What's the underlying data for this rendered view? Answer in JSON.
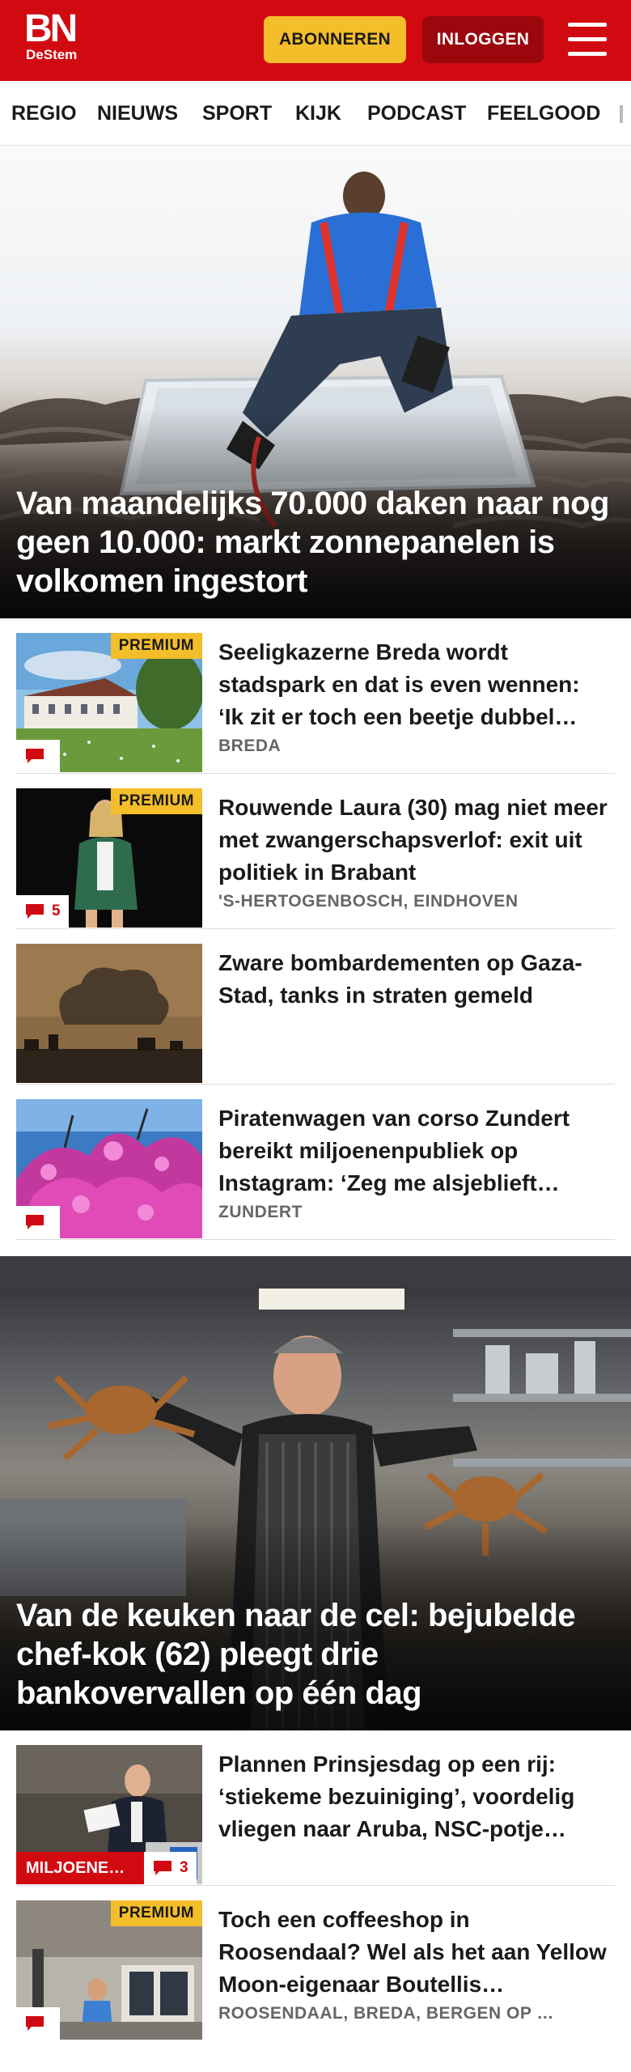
{
  "header": {
    "logo_main": "BN",
    "logo_sub": "DeStem",
    "subscribe_label": "ABONNEREN",
    "login_label": "INLOGGEN",
    "brand_color": "#d10a11",
    "subscribe_color": "#f4bd2a"
  },
  "nav": {
    "items": [
      "REGIO",
      "NIEUWS",
      "SPORT",
      "KIJK",
      "PODCAST",
      "FEELGOOD"
    ]
  },
  "hero_1": {
    "title": "Van maandelijks 70.000 daken naar nog geen 10.000: markt zonnepanelen is volkomen ingestort"
  },
  "articles_1": [
    {
      "title": "Seeligkazerne Breda wordt stadspark en dat is even wennen: ‘Ik zit er toch een beetje dubbel…",
      "location": "BREDA",
      "badge": "PREMIUM",
      "comments": ""
    },
    {
      "title": "Rouwende Laura (30) mag niet meer met zwangerschapsverlof: exit uit politiek in Brabant",
      "location": "'S-HERTOGENBOSCH, EINDHOVEN",
      "badge": "PREMIUM",
      "comments": "5"
    },
    {
      "title": "Zware bombardementen op Gaza-Stad, tanks in straten gemeld"
    },
    {
      "title": "Piratenwagen van corso Zundert bereikt miljoenenpubliek op Instagram: ‘Zeg me alsjeblieft…",
      "location": "ZUNDERT",
      "comments": ""
    }
  ],
  "hero_2": {
    "title": "Van de keuken naar de cel: bejubelde chef-kok (62) pleegt drie bankovervallen op één dag"
  },
  "articles_2": [
    {
      "title": "Plannen Prinsjesdag op een rij: ‘stiekeme bezuiniging’, voordelig vliegen naar Aruba, NSC-potje…",
      "tag": "MILJOENE…",
      "comments": "3"
    },
    {
      "title": "Toch een coffeeshop in Roosendaal? Wel als het aan Yellow Moon-eigenaar Boutellis…",
      "location": "ROOSENDAAL, BREDA, BERGEN OP …",
      "badge": "PREMIUM",
      "comments": ""
    }
  ]
}
